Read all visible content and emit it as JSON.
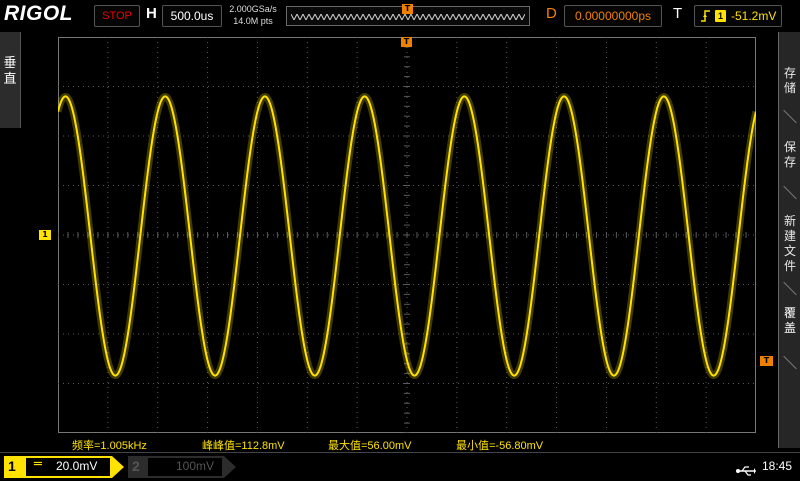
{
  "brand": "RIGOL",
  "top": {
    "run_state": "STOP",
    "h_label": "H",
    "timebase": "500.0us",
    "sample_rate": "2.000GSa/s",
    "memory_depth": "14.0M pts",
    "trigger_position_glyph": "T",
    "d_label": "D",
    "delay": "0.00000000ps",
    "t_label": "T",
    "trigger_source": "1",
    "trigger_level": "-51.2mV",
    "trigger_edge_icon": "rising-edge-icon"
  },
  "left_tab": {
    "label_line1": "垂",
    "label_line2": "直"
  },
  "markers": {
    "ch1": "1",
    "trigger_level_glyph": "T",
    "trigger_time_glyph": "T"
  },
  "right_menu": [
    {
      "line1": "存",
      "line2": "储"
    },
    {
      "line1": "保",
      "line2": "存"
    },
    {
      "line1": "新",
      "line2": "建",
      "line3": "文",
      "line4": "件"
    },
    {
      "line1": "覆",
      "line2": "盖"
    }
  ],
  "measurements": {
    "freq": "频率=1.005kHz",
    "vpp": "峰峰值=112.8mV",
    "vmax": "最大值=56.00mV",
    "vmin": "最小值=-56.80mV"
  },
  "bottom": {
    "ch1_num": "1",
    "ch1_coupling_glyph": "═",
    "ch1_scale": "20.0mV",
    "ch2_num": "2",
    "ch2_scale": "100mV",
    "time": "18:45"
  },
  "colors": {
    "ch1": "#ffe200",
    "trigger": "#f08000",
    "stop": "#ee0000",
    "grid": "#5a5a5a"
  },
  "waveform": {
    "cycles_on_screen": 7,
    "frequency": "1.005kHz",
    "vmax_mV": 56.0,
    "vmin_mV": -56.8,
    "vertical_scale_mV_per_div": 20.0,
    "horizontal_scale_us_per_div": 500.0
  }
}
